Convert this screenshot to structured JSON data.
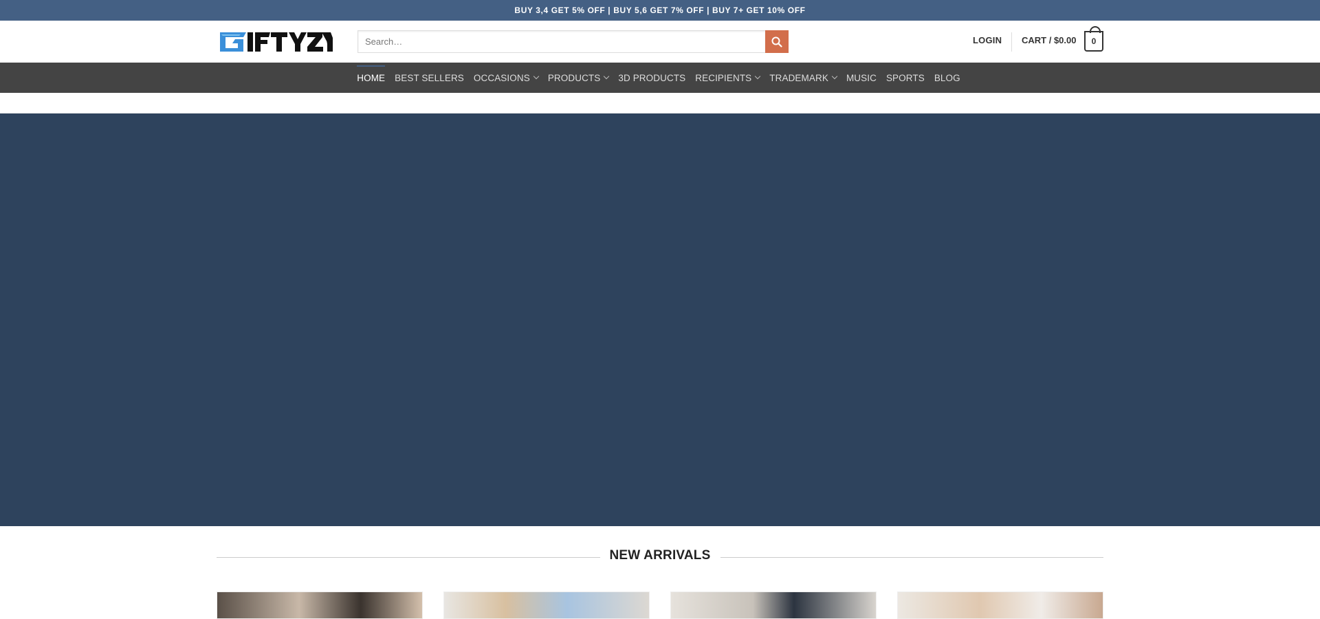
{
  "topbar": {
    "promo": "BUY 3,4 GET 5% OFF | BUY 5,6 GET 7% OFF | BUY 7+ GET 10% OFF"
  },
  "header": {
    "logo_text": "GIFTYZY",
    "search_placeholder": "Search…",
    "login_label": "LOGIN",
    "cart_label": "CART / $0.00",
    "cart_count": "0"
  },
  "nav": {
    "items": [
      {
        "label": "HOME",
        "dropdown": false,
        "active": true
      },
      {
        "label": "BEST SELLERS",
        "dropdown": false
      },
      {
        "label": "OCCASIONS",
        "dropdown": true
      },
      {
        "label": "PRODUCTS",
        "dropdown": true
      },
      {
        "label": "3D PRODUCTS",
        "dropdown": false
      },
      {
        "label": "RECIPIENTS",
        "dropdown": true
      },
      {
        "label": "TRADEMARK",
        "dropdown": true
      },
      {
        "label": "MUSIC",
        "dropdown": false
      },
      {
        "label": "SPORTS",
        "dropdown": false
      },
      {
        "label": "BLOG",
        "dropdown": false
      }
    ]
  },
  "section": {
    "title": "NEW ARRIVALS"
  },
  "colors": {
    "topbar": "#446084",
    "nav": "#444444",
    "hero": "#2e435d",
    "search_button": "#d26e4b"
  },
  "icons": {
    "search": "search-icon",
    "cart": "cart-icon"
  }
}
